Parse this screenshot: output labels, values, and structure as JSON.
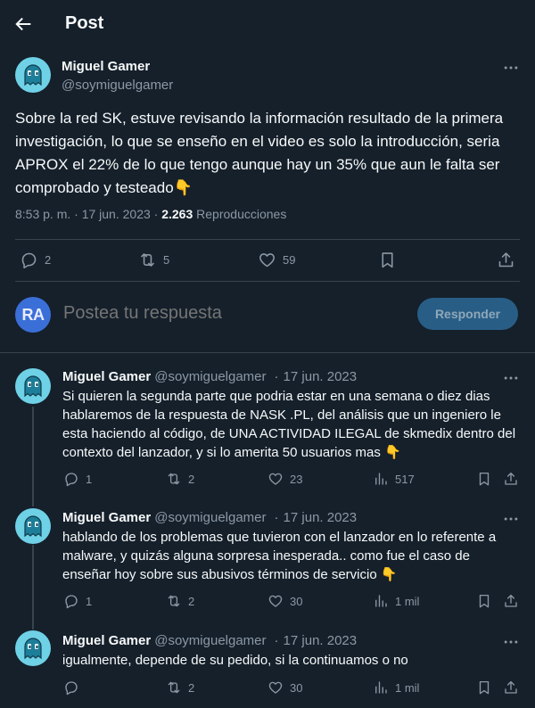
{
  "header": {
    "title": "Post"
  },
  "post": {
    "author_name": "Miguel Gamer",
    "author_handle": "@soymiguelgamer",
    "text": "Sobre la red SK, estuve revisando la información resultado de la primera investigación, lo que se enseño en el video es solo la introducción, seria APROX el 22% de lo que tengo aunque hay un 35% que aun le falta ser comprobado y testeado👇",
    "time": "8:53 p. m. · 17 jun. 2023 · ",
    "views_count": "2.263",
    "views_label": " Reproducciones",
    "replies": "2",
    "reposts": "5",
    "likes": "59"
  },
  "reply_box": {
    "avatar_initials": "RA",
    "placeholder": "Postea tu respuesta",
    "button_label": "Responder"
  },
  "replies": [
    {
      "author_name": "Miguel Gamer",
      "author_handle": "@soymiguelgamer",
      "separator": "·",
      "date": "17 jun. 2023",
      "text": "Si quieren la segunda parte que podria estar en una semana o diez dias hablaremos de la respuesta de NASK .PL, del análisis que un ingeniero le esta haciendo al código, de UNA ACTIVIDAD ILEGAL de skmedix dentro del contexto del lanzador, y si lo amerita 50 usuarios mas 👇",
      "replies": "1",
      "reposts": "2",
      "likes": "23",
      "views": "517"
    },
    {
      "author_name": "Miguel Gamer",
      "author_handle": "@soymiguelgamer",
      "separator": "·",
      "date": "17 jun. 2023",
      "text": "hablando de los problemas que tuvieron con el lanzador en lo referente a malware, y quizás alguna sorpresa inesperada.. como fue el caso de enseñar hoy sobre sus abusivos términos de servicio 👇",
      "replies": "1",
      "reposts": "2",
      "likes": "30",
      "views": "1 mil"
    },
    {
      "author_name": "Miguel Gamer",
      "author_handle": "@soymiguelgamer",
      "separator": "·",
      "date": "17 jun. 2023",
      "text": "igualmente, depende de su pedido, si la continuamos o no",
      "replies": "",
      "reposts": "2",
      "likes": "30",
      "views": "1 mil"
    }
  ],
  "colors": {
    "background": "#15202b",
    "text": "#f7f9f9",
    "muted": "#8b98a5",
    "divider": "#38444d",
    "avatar": "#6fd1e6",
    "button": "#285e86"
  }
}
